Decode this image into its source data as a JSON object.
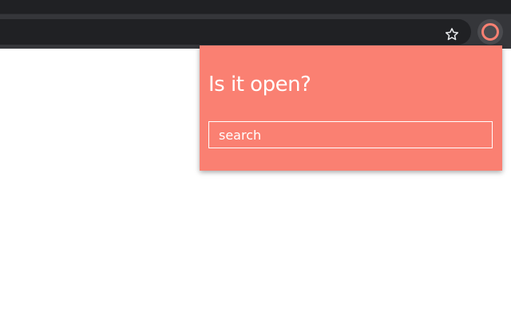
{
  "colors": {
    "accent": "#fa8072",
    "popup_background": "#fa8072",
    "toolbar": "#35363a",
    "tab_strip": "#202124"
  },
  "browser": {
    "toolbar": {
      "bookmark_icon": "star-outline-icon",
      "extension_icon": "ring-icon"
    }
  },
  "popup": {
    "title": "Is it open?",
    "search": {
      "placeholder": "search",
      "value": ""
    }
  }
}
